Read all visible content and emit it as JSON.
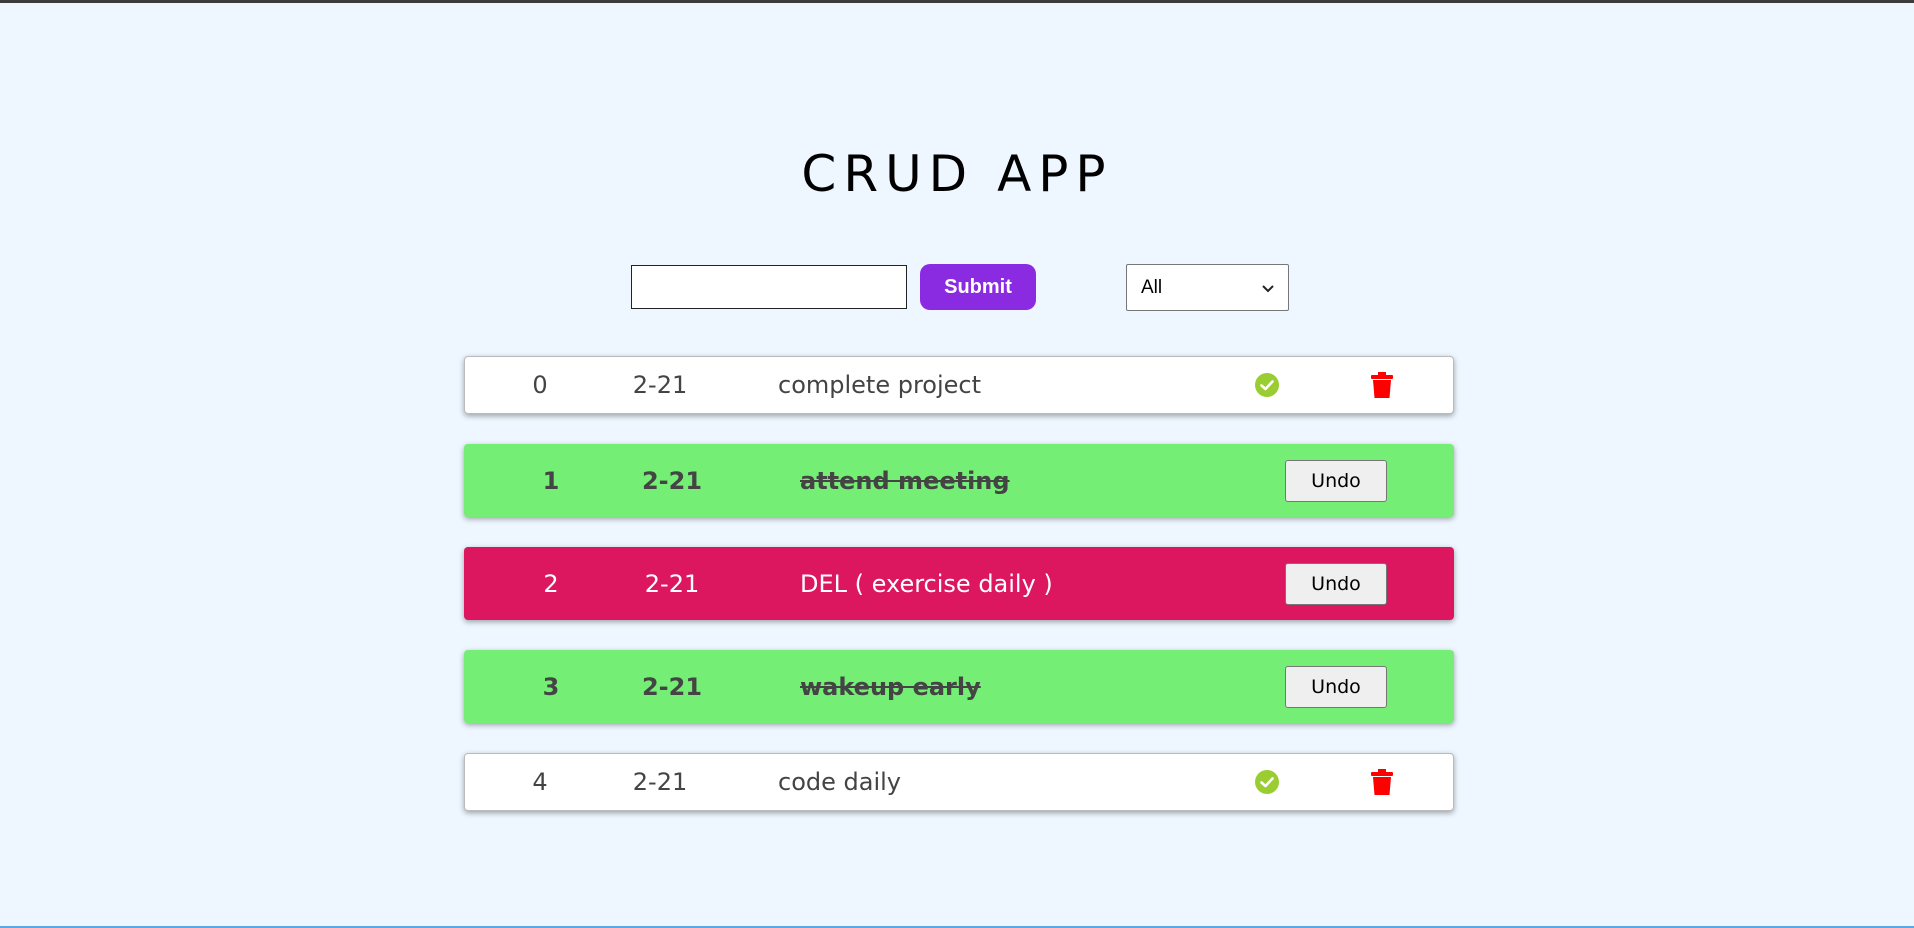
{
  "app": {
    "title": "CRUD APP"
  },
  "form": {
    "input_value": "",
    "input_placeholder": "",
    "submit_label": "Submit",
    "filter_selected": "All"
  },
  "colors": {
    "accent": "#8a2be2",
    "done_row": "#74ee75",
    "deleted_row": "#dc1760",
    "check_icon": "#9acd32",
    "trash_icon": "#ff0000"
  },
  "todos": [
    {
      "id": "0",
      "date": "2-21",
      "text": "complete project",
      "status": "pending"
    },
    {
      "id": "1",
      "date": "2-21",
      "text": "attend meeting",
      "status": "done",
      "action_label": "Undo"
    },
    {
      "id": "2",
      "date": "2-21",
      "text": "DEL ( exercise daily )",
      "status": "deleted",
      "action_label": "Undo"
    },
    {
      "id": "3",
      "date": "2-21",
      "text": "wakeup early",
      "status": "done",
      "action_label": "Undo"
    },
    {
      "id": "4",
      "date": "2-21",
      "text": "code daily",
      "status": "pending"
    }
  ]
}
